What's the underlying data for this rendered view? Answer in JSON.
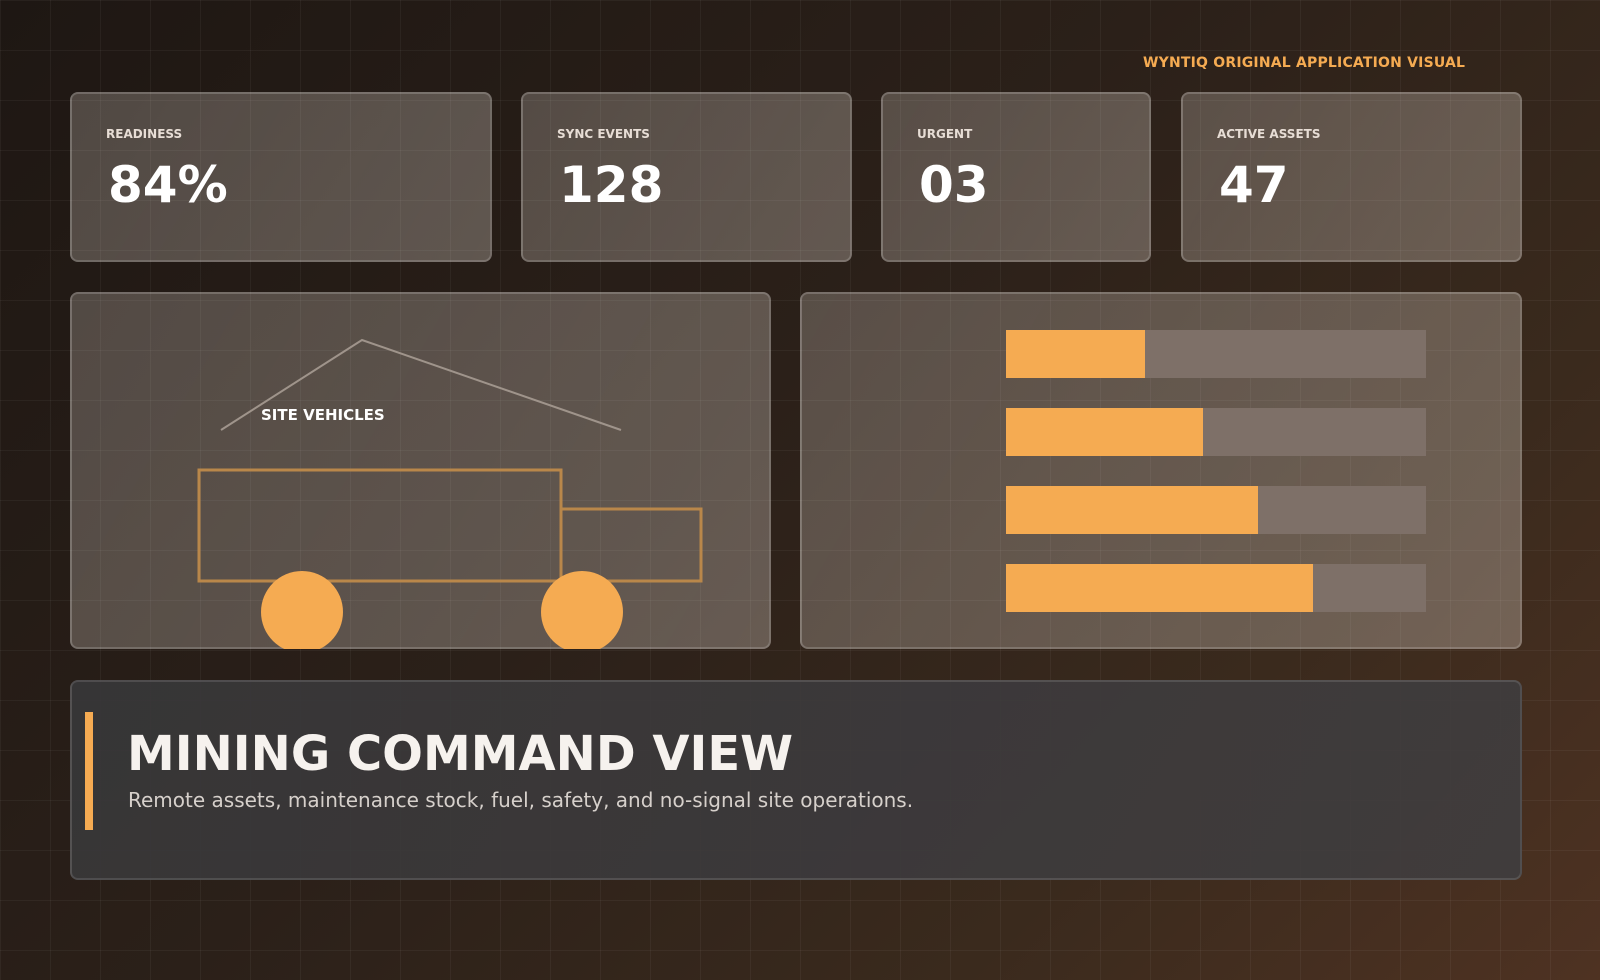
{
  "brand_label": "WYNTIQ ORIGINAL APPLICATION VISUAL",
  "colors": {
    "accent": "#f5ab52",
    "bar_track": "#7e7068",
    "vehicle_outline": "#b9874a",
    "roof_line": "#9f948b"
  },
  "stats": [
    {
      "label": "READINESS",
      "value": "84%"
    },
    {
      "label": "SYNC EVENTS",
      "value": "128"
    },
    {
      "label": "URGENT",
      "value": "03"
    },
    {
      "label": "ACTIVE ASSETS",
      "value": "47"
    }
  ],
  "vehicle_panel": {
    "label": "SITE VEHICLES",
    "icon": "truck-icon"
  },
  "bar_panel": {
    "bars": [
      {
        "fill": 0.33
      },
      {
        "fill": 0.47
      },
      {
        "fill": 0.6
      },
      {
        "fill": 0.73
      }
    ]
  },
  "hero": {
    "title": "MINING COMMAND VIEW",
    "subtitle": "Remote assets, maintenance stock, fuel, safety, and no-signal site operations."
  }
}
